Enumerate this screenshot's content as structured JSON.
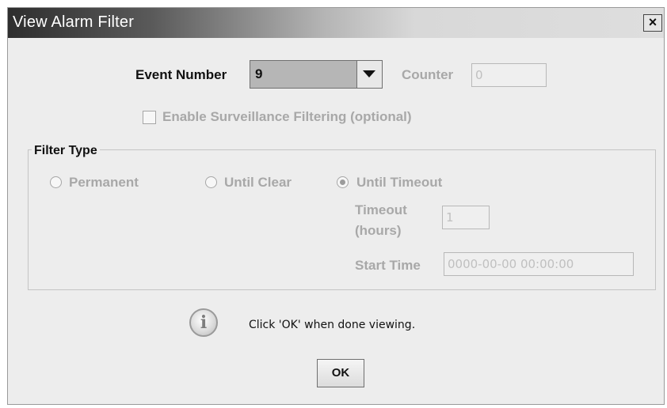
{
  "window": {
    "title": "View Alarm Filter",
    "close_symbol": "×"
  },
  "event_number": {
    "label": "Event Number",
    "selected_value": "9"
  },
  "counter": {
    "label": "Counter",
    "value": "0"
  },
  "surveillance": {
    "label": "Enable Surveillance Filtering (optional)",
    "checked": false
  },
  "filter_type": {
    "title": "Filter Type",
    "options": [
      {
        "label": "Permanent",
        "selected": false
      },
      {
        "label": "Until Clear",
        "selected": false
      },
      {
        "label": "Until Timeout",
        "selected": true
      }
    ]
  },
  "timeout": {
    "label_line1": "Timeout",
    "label_line2": "(hours)",
    "value": "1"
  },
  "start_time": {
    "label": "Start Time",
    "value": "0000-00-00 00:00:00"
  },
  "info": {
    "icon": "info-icon",
    "message": "Click 'OK' when done viewing."
  },
  "buttons": {
    "ok": "OK"
  },
  "colors": {
    "dialog_background": "#ededed",
    "disabled_text": "#a8a8a8"
  }
}
